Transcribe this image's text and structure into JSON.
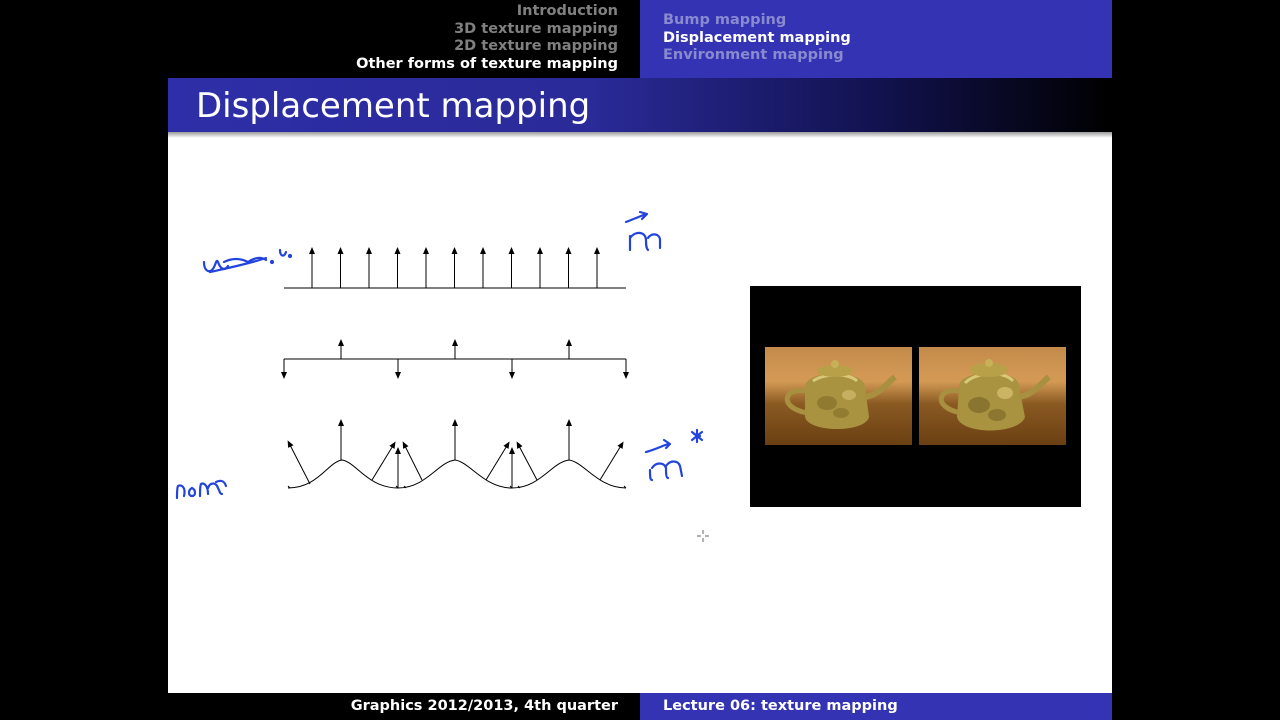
{
  "nav": {
    "sections": [
      "Introduction",
      "3D texture mapping",
      "2D texture mapping",
      "Other forms of texture mapping"
    ],
    "active_section": 3,
    "subsections": [
      "Bump mapping",
      "Displacement mapping",
      "Environment mapping"
    ],
    "active_subsection": 1
  },
  "frame": {
    "title": "Displacement mapping"
  },
  "footer": {
    "left": "Graphics 2012/2013, 4th quarter",
    "right": "Lecture 06: texture mapping"
  },
  "annotations": {
    "color": "#2244dd",
    "handwriting": [
      "n",
      "n*"
    ]
  },
  "colors": {
    "nav_bar": "#3333b3",
    "title_bar": "#2e2ea8"
  }
}
